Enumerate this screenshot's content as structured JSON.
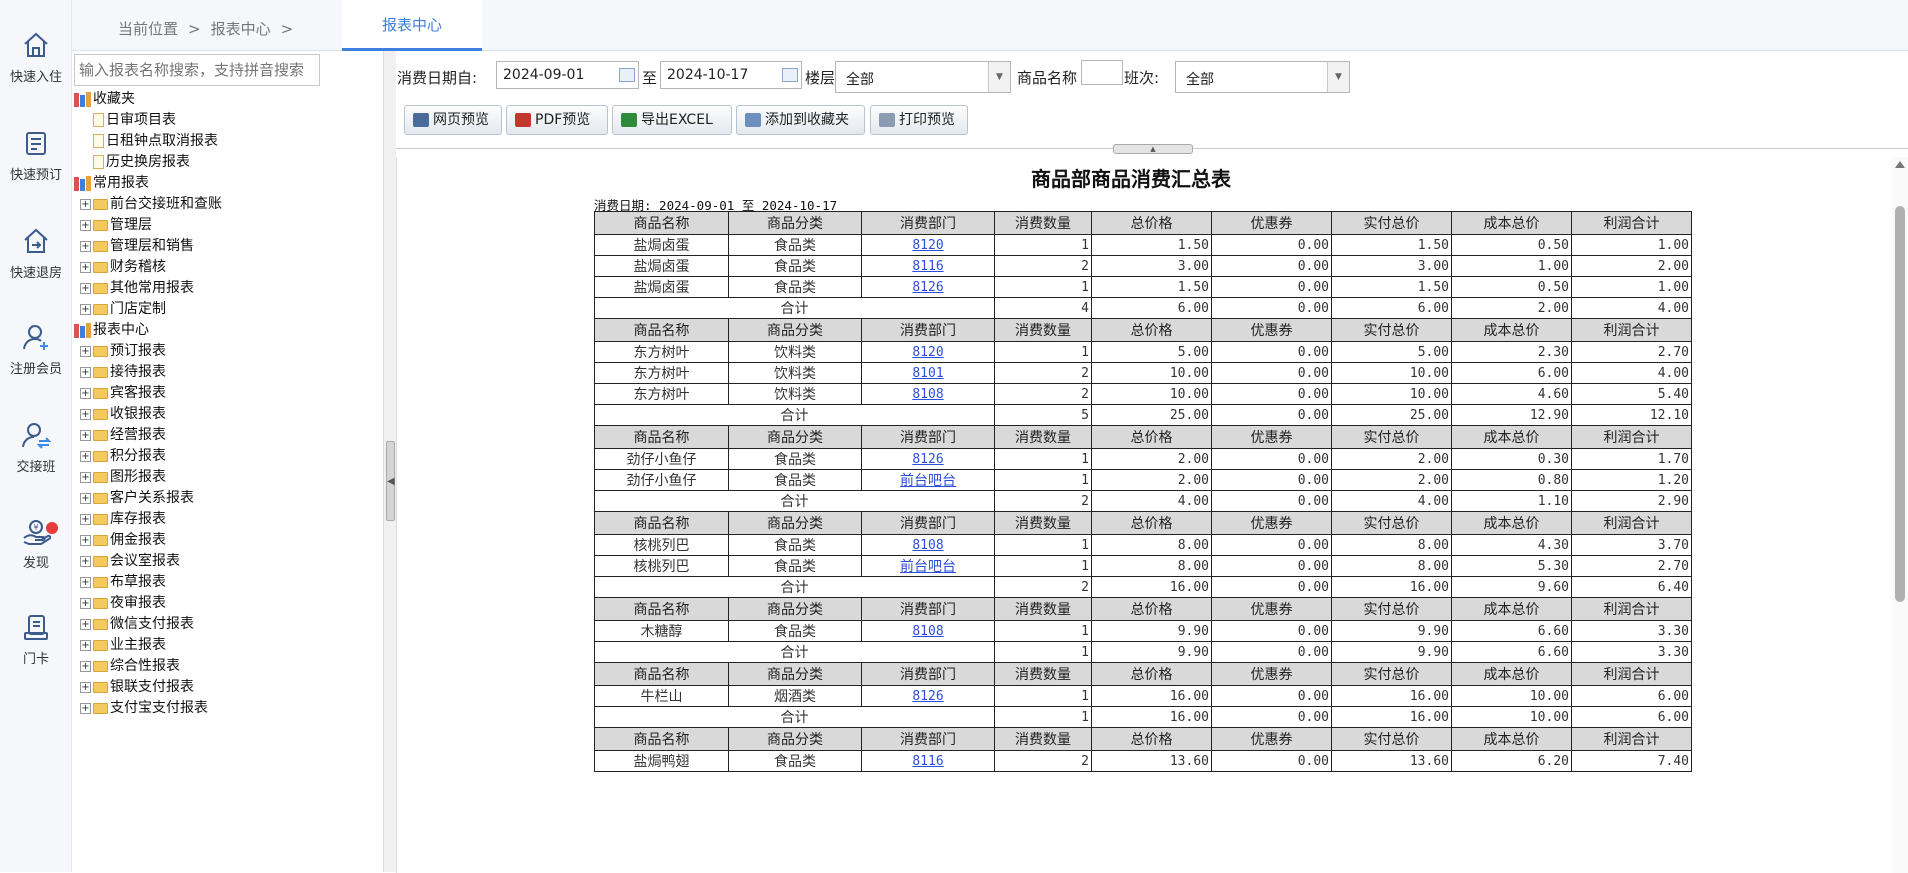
{
  "rail": [
    {
      "label": "快速入住",
      "icon": "home-icon"
    },
    {
      "label": "快速预订",
      "icon": "booking-icon"
    },
    {
      "label": "快速退房",
      "icon": "checkout-icon"
    },
    {
      "label": "注册会员",
      "icon": "add-member-icon"
    },
    {
      "label": "交接班",
      "icon": "shift-handover-icon"
    },
    {
      "label": "发现",
      "icon": "discover-icon"
    },
    {
      "label": "门卡",
      "icon": "door-card-icon"
    }
  ],
  "breadcrumb": {
    "prefix": "当前位置",
    "sep1": ">",
    "crumb": "报表中心",
    "sep2": ">"
  },
  "active_tab": "报表中心",
  "tree_search_placeholder": "输入报表名称搜索，支持拼音搜索",
  "tree": {
    "favorites": {
      "label": "收藏夹",
      "items": [
        "日审项目表",
        "日租钟点取消报表",
        "历史换房报表"
      ]
    },
    "common": {
      "label": "常用报表",
      "items": [
        "前台交接班和查账",
        "管理层",
        "管理层和销售",
        "财务稽核",
        "其他常用报表",
        "门店定制"
      ]
    },
    "center": {
      "label": "报表中心",
      "items": [
        "预订报表",
        "接待报表",
        "宾客报表",
        "收银报表",
        "经营报表",
        "积分报表",
        "图形报表",
        "客户关系报表",
        "库存报表",
        "佣金报表",
        "会议室报表",
        "布草报表",
        "夜审报表",
        "微信支付报表",
        "业主报表",
        "综合性报表",
        "银联支付报表",
        "支付宝支付报表"
      ]
    }
  },
  "filters": {
    "date_label": "消费日期自:",
    "date_from": "2024-09-01",
    "to_label": "至",
    "date_to": "2024-10-17",
    "floor_label": "楼层",
    "floor_value": "全部",
    "product_label": "商品名称",
    "product_value": "",
    "shift_label": "班次:",
    "shift_value": "全部"
  },
  "toolbar": {
    "web_preview": "网页预览",
    "pdf_preview": "PDF预览",
    "export_excel": "导出EXCEL",
    "add_favorite": "添加到收藏夹",
    "print_preview": "打印预览"
  },
  "report": {
    "title": "商品部商品消费汇总表",
    "date_range": "消费日期: 2024-09-01 至 2024-10-17",
    "headers": [
      "商品名称",
      "商品分类",
      "消费部门",
      "消费数量",
      "总价格",
      "优惠券",
      "实付总价",
      "成本总价",
      "利润合计"
    ],
    "total_label": "合计",
    "groups": [
      {
        "rows": [
          [
            "盐焗卤蛋",
            "食品类",
            "8120",
            "1",
            "1.50",
            "0.00",
            "1.50",
            "0.50",
            "1.00"
          ],
          [
            "盐焗卤蛋",
            "食品类",
            "8116",
            "2",
            "3.00",
            "0.00",
            "3.00",
            "1.00",
            "2.00"
          ],
          [
            "盐焗卤蛋",
            "食品类",
            "8126",
            "1",
            "1.50",
            "0.00",
            "1.50",
            "0.50",
            "1.00"
          ]
        ],
        "total": [
          "4",
          "6.00",
          "0.00",
          "6.00",
          "2.00",
          "4.00"
        ]
      },
      {
        "rows": [
          [
            "东方树叶",
            "饮料类",
            "8120",
            "1",
            "5.00",
            "0.00",
            "5.00",
            "2.30",
            "2.70"
          ],
          [
            "东方树叶",
            "饮料类",
            "8101",
            "2",
            "10.00",
            "0.00",
            "10.00",
            "6.00",
            "4.00"
          ],
          [
            "东方树叶",
            "饮料类",
            "8108",
            "2",
            "10.00",
            "0.00",
            "10.00",
            "4.60",
            "5.40"
          ]
        ],
        "total": [
          "5",
          "25.00",
          "0.00",
          "25.00",
          "12.90",
          "12.10"
        ]
      },
      {
        "rows": [
          [
            "劲仔小鱼仔",
            "食品类",
            "8126",
            "1",
            "2.00",
            "0.00",
            "2.00",
            "0.30",
            "1.70"
          ],
          [
            "劲仔小鱼仔",
            "食品类",
            "前台吧台",
            "1",
            "2.00",
            "0.00",
            "2.00",
            "0.80",
            "1.20"
          ]
        ],
        "total": [
          "2",
          "4.00",
          "0.00",
          "4.00",
          "1.10",
          "2.90"
        ]
      },
      {
        "rows": [
          [
            "核桃列巴",
            "食品类",
            "8108",
            "1",
            "8.00",
            "0.00",
            "8.00",
            "4.30",
            "3.70"
          ],
          [
            "核桃列巴",
            "食品类",
            "前台吧台",
            "1",
            "8.00",
            "0.00",
            "8.00",
            "5.30",
            "2.70"
          ]
        ],
        "total": [
          "2",
          "16.00",
          "0.00",
          "16.00",
          "9.60",
          "6.40"
        ]
      },
      {
        "rows": [
          [
            "木糖醇",
            "食品类",
            "8108",
            "1",
            "9.90",
            "0.00",
            "9.90",
            "6.60",
            "3.30"
          ]
        ],
        "total": [
          "1",
          "9.90",
          "0.00",
          "9.90",
          "6.60",
          "3.30"
        ]
      },
      {
        "rows": [
          [
            "牛栏山",
            "烟酒类",
            "8126",
            "1",
            "16.00",
            "0.00",
            "16.00",
            "10.00",
            "6.00"
          ]
        ],
        "total": [
          "1",
          "16.00",
          "0.00",
          "16.00",
          "10.00",
          "6.00"
        ]
      },
      {
        "rows": [
          [
            "盐焗鸭翅",
            "食品类",
            "8116",
            "2",
            "13.60",
            "0.00",
            "13.60",
            "6.20",
            "7.40"
          ]
        ],
        "total": null
      }
    ]
  },
  "colors": {
    "accent": "#3d7fe0",
    "link": "#2d4fd8",
    "header_bg": "#d9d9d9",
    "notify_dot": "#e63b3b"
  }
}
